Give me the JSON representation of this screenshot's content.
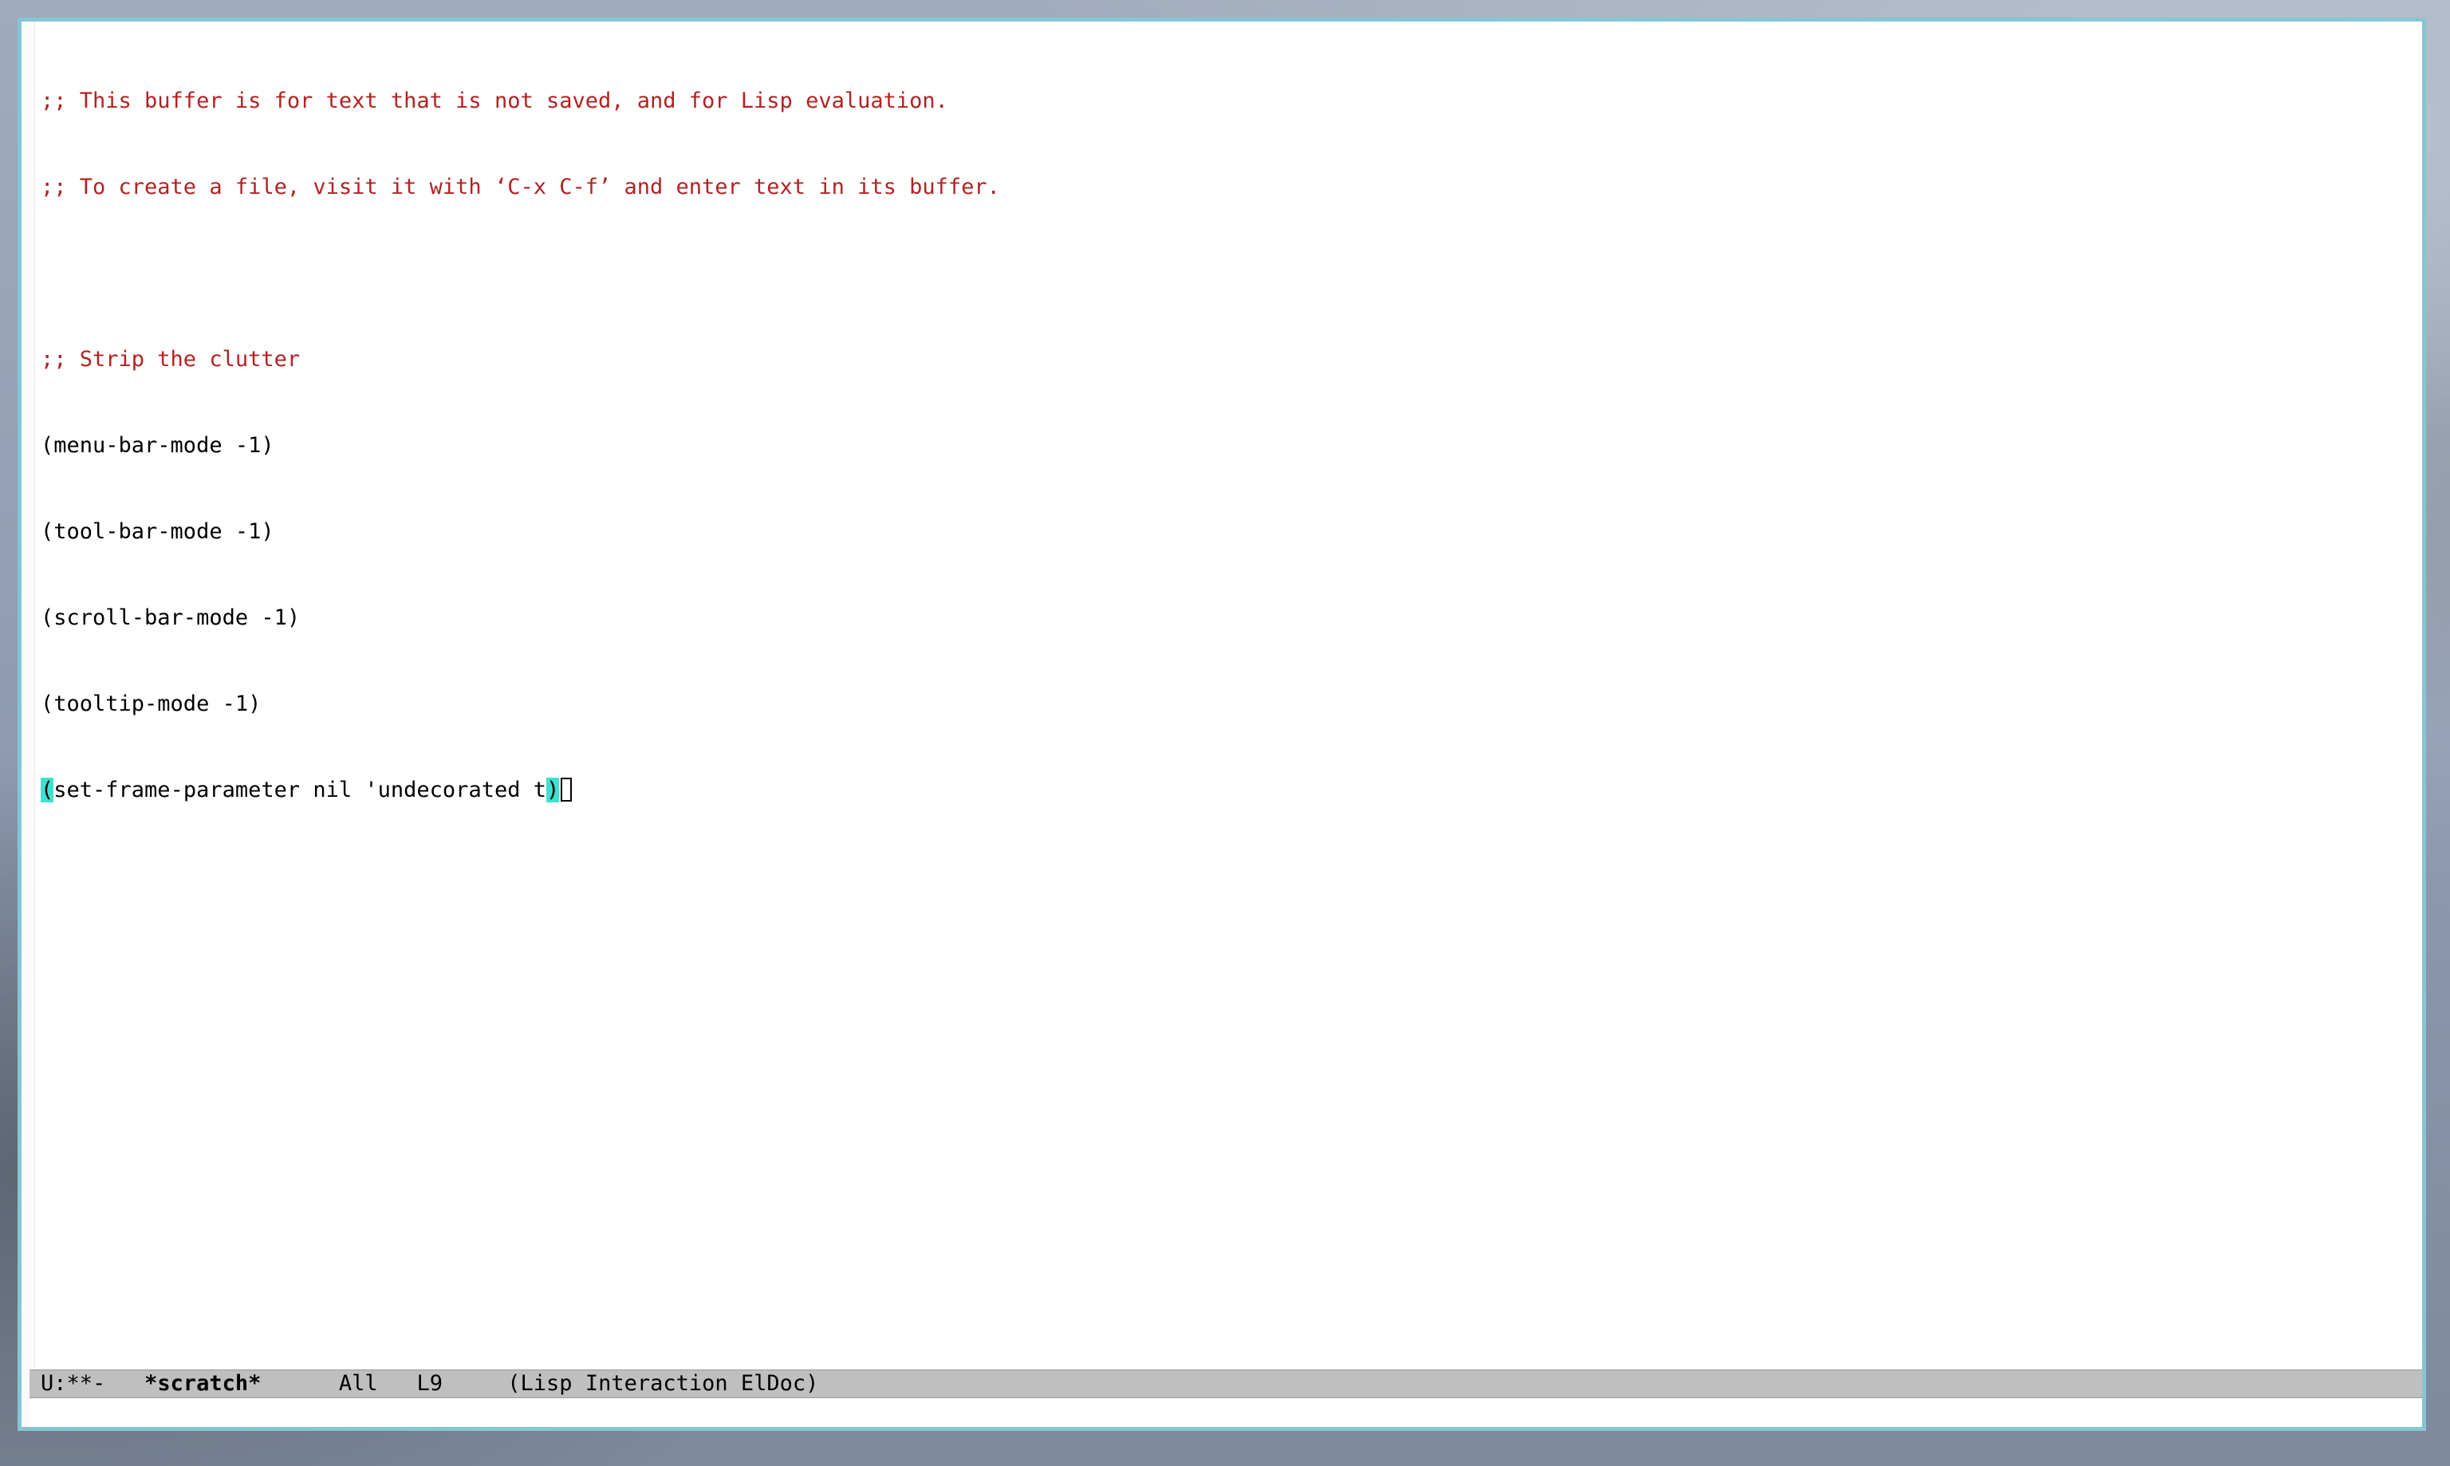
{
  "buffer": {
    "lines": [
      ";; This buffer is for text that is not saved, and for Lisp evaluation.",
      ";; To create a file, visit it with ‘C-x C-f’ and enter text in its buffer.",
      "",
      ";; Strip the clutter",
      "(menu-bar-mode -1)",
      "(tool-bar-mode -1)",
      "(scroll-bar-mode -1)",
      "(tooltip-mode -1)"
    ],
    "last_line": {
      "open_paren": "(",
      "body": "set-frame-parameter nil 'undecorated t",
      "close_paren": ")"
    }
  },
  "modeline": {
    "status": "U:**-",
    "buffer_name": "*scratch*",
    "position": "All",
    "line": "L9",
    "modes": "(Lisp Interaction ElDoc)"
  },
  "colors": {
    "comment": "#b22222",
    "paren_match": "#40e0d0",
    "modeline_bg": "#bfbfbf",
    "frame_border": "#86c6d2"
  }
}
